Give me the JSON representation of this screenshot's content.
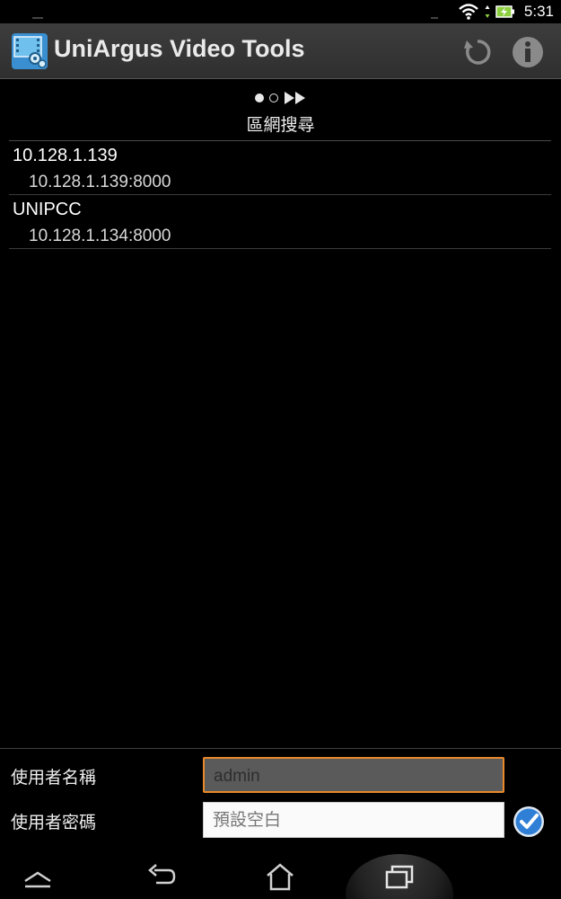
{
  "status_bar": {
    "time": "5:31",
    "icons": [
      "wifi-icon",
      "battery-charging-icon"
    ]
  },
  "app_bar": {
    "title": "UniArgus Video Tools",
    "icons": [
      "app-logo-icon",
      "refresh-icon",
      "info-icon"
    ]
  },
  "page": {
    "title": "區網搜尋",
    "indicator_icons": [
      "page-dot-active",
      "page-dot-inactive",
      "fast-forward-icon"
    ]
  },
  "devices": [
    {
      "name": "10.128.1.139",
      "address": "10.128.1.139:8000"
    },
    {
      "name": "UNIPCC",
      "address": "10.128.1.134:8000"
    }
  ],
  "form": {
    "username_label": "使用者名稱",
    "username_value": "admin",
    "password_label": "使用者密碼",
    "password_placeholder": "預設空白"
  },
  "nav_bar": {
    "icons": [
      "up-chevron-icon",
      "back-icon",
      "home-icon",
      "recent-apps-icon"
    ]
  },
  "colors": {
    "accent": "#e8892a",
    "check_blue": "#2f7fd6",
    "action_bar": "#363636"
  }
}
